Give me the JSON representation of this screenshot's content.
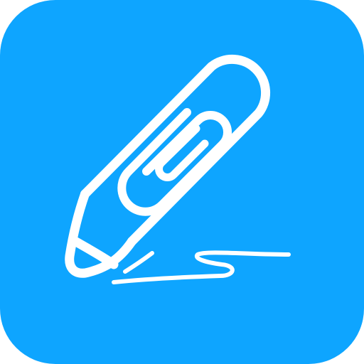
{
  "icon": {
    "name": "pen-paperclip-signature-icon",
    "colors": {
      "background": "#0ea5ff",
      "foreground": "#ffffff",
      "page": "#ffffff"
    }
  }
}
